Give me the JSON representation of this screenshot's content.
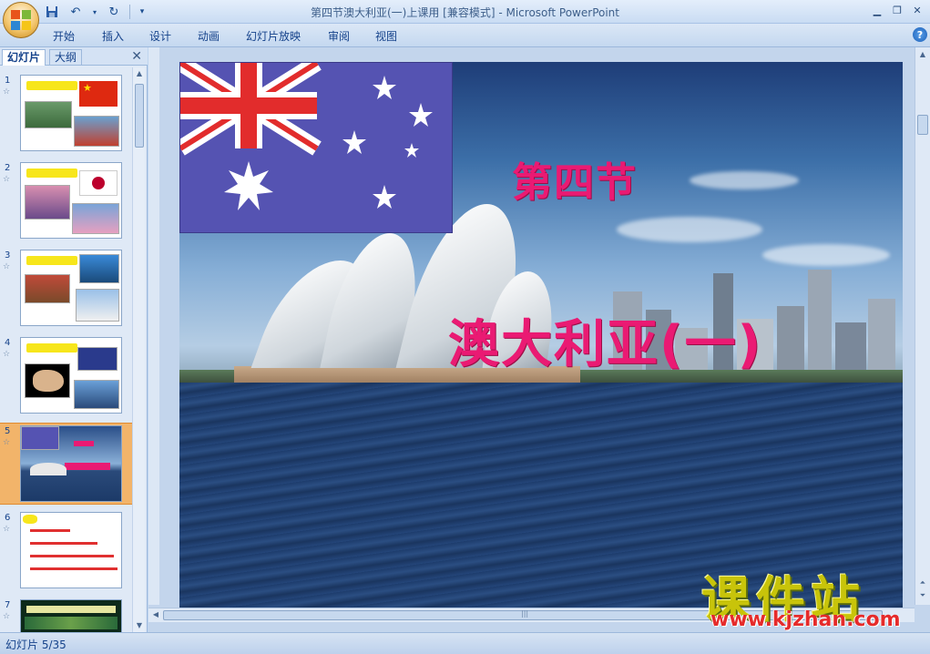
{
  "window": {
    "title": "第四节澳大利亚(一)上课用 [兼容模式] - Microsoft PowerPoint"
  },
  "quick_access": {
    "icons": [
      "save-icon",
      "undo-icon",
      "redo-icon",
      "customize-icon"
    ]
  },
  "ribbon": {
    "tabs": [
      "开始",
      "插入",
      "设计",
      "动画",
      "幻灯片放映",
      "审阅",
      "视图"
    ]
  },
  "left_pane": {
    "tabs": [
      "幻灯片",
      "大纲"
    ],
    "close_label": "✕",
    "slides": [
      {
        "number": "1"
      },
      {
        "number": "2"
      },
      {
        "number": "3"
      },
      {
        "number": "4"
      },
      {
        "number": "5"
      },
      {
        "number": "6"
      },
      {
        "number": "7"
      }
    ]
  },
  "slide": {
    "heading": "第四节",
    "title": "澳大利亚(一)"
  },
  "watermark": {
    "brand": "课件站",
    "url": "www.kjzhan.com"
  },
  "status": {
    "slide_indicator": "幻灯片 5/35"
  },
  "colors": {
    "heading": "#ea1a73",
    "selected_thumb": "#f2b46a",
    "flag_blue": "#5553b2"
  }
}
